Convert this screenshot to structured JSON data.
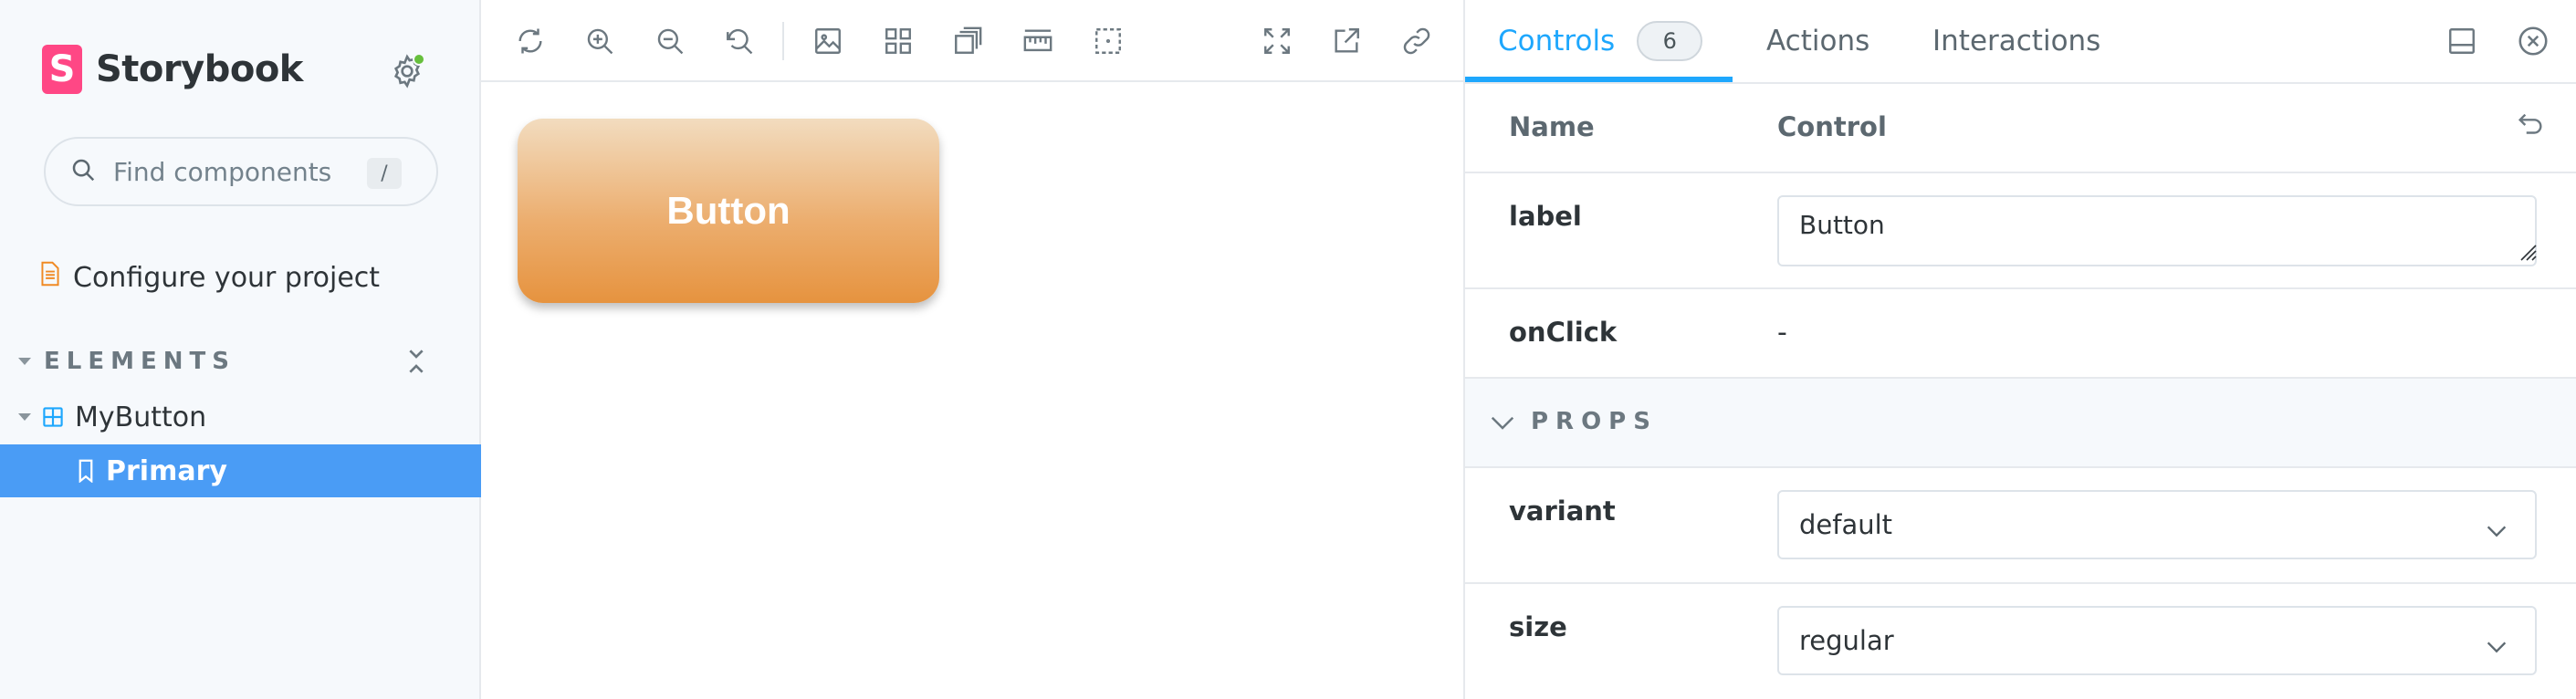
{
  "brand": {
    "name": "Storybook",
    "logo_letter": "S",
    "logo_color": "#ff4785"
  },
  "search": {
    "placeholder": "Find components",
    "shortcut": "/"
  },
  "sidebar": {
    "configure_label": "Configure your project",
    "group_label": "ELEMENTS",
    "component_label": "MyButton",
    "story_label": "Primary",
    "selected_color": "#4a9cf5"
  },
  "toolbar": {
    "icons": [
      "remount-icon",
      "zoom-in-icon",
      "zoom-out-icon",
      "zoom-reset-icon",
      "background-icon",
      "grid-icon",
      "viewport-icon",
      "measure-icon",
      "outline-icon",
      "fullscreen-icon",
      "open-new-tab-icon",
      "copy-link-icon"
    ]
  },
  "canvas": {
    "button_label": "Button"
  },
  "panel": {
    "tabs": [
      {
        "label": "Controls",
        "badge": "6",
        "active": true
      },
      {
        "label": "Actions"
      },
      {
        "label": "Interactions"
      }
    ],
    "accent_color": "#1ea7fd",
    "header": {
      "name": "Name",
      "control": "Control"
    },
    "rows": {
      "label": {
        "name": "label",
        "value": "Button"
      },
      "onclick": {
        "name": "onClick",
        "value": "-"
      },
      "section": "PROPS",
      "variant": {
        "name": "variant",
        "value": "default"
      },
      "size": {
        "name": "size",
        "value": "regular"
      }
    }
  }
}
